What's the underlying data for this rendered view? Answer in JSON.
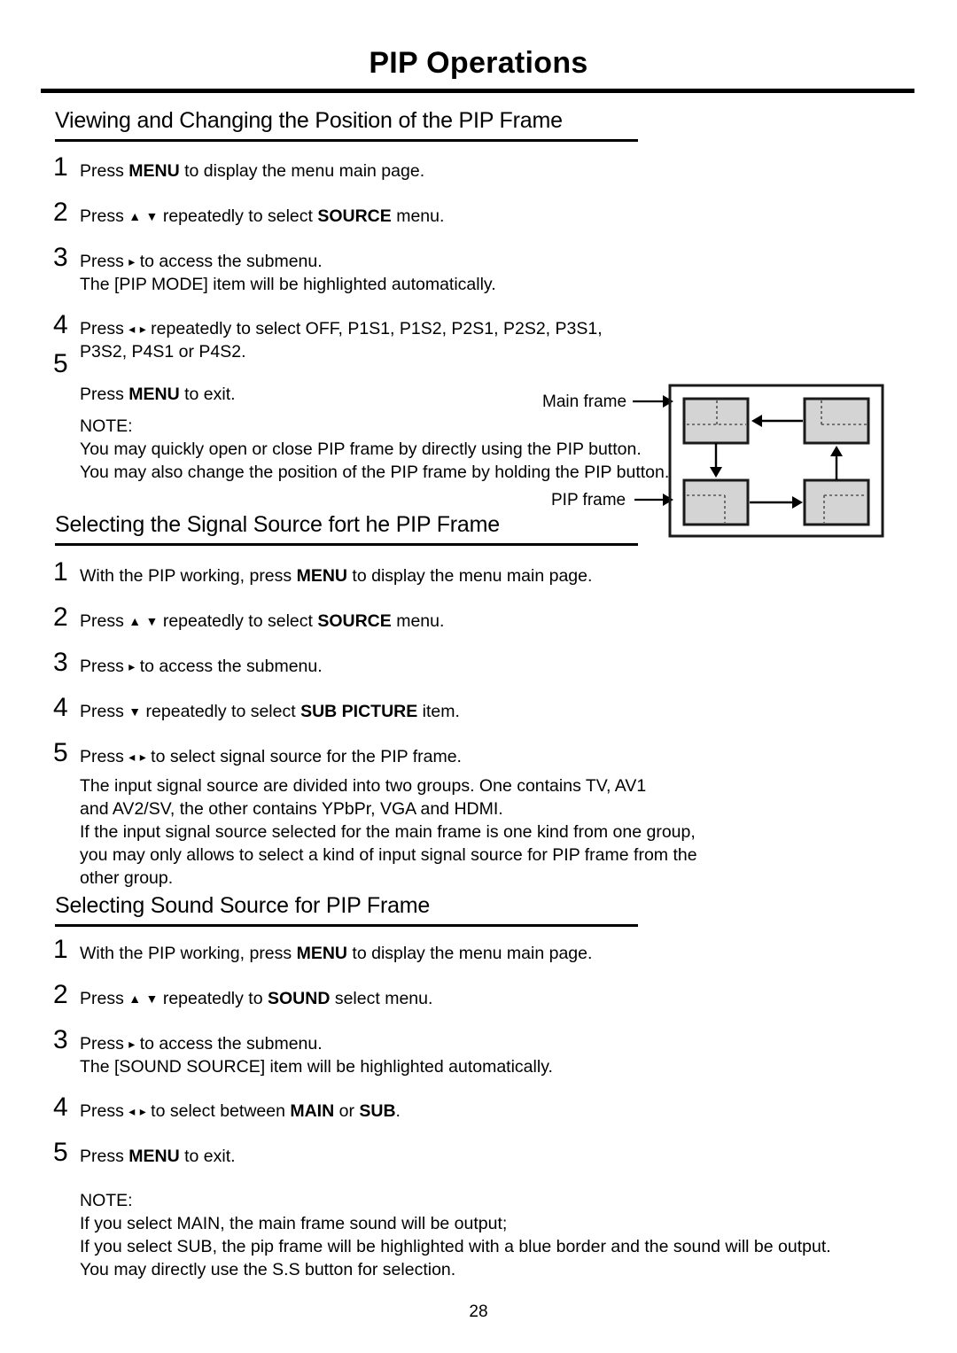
{
  "document": {
    "title": "PIP Operations",
    "page_number": "28"
  },
  "sections": [
    {
      "heading": "Viewing and Changing the Position of the PIP Frame",
      "steps": [
        {
          "num": "1",
          "text_html": "Press <b>MENU</b> to display the menu main page."
        },
        {
          "num": "2",
          "text_html": "Press <span class=\"glyph\">▲</span> <span class=\"glyph\">▼</span> repeatedly to select <b>SOURCE</b> menu."
        },
        {
          "num": "3",
          "text_html": "Press <span class=\"glyph\">▸</span> to access the submenu.<br>The [PIP MODE] item will be highlighted automatically."
        },
        {
          "num": "4",
          "text_html": "Press <span class=\"glyph\">◂</span> <span class=\"glyph\">▸</span> repeatedly to select OFF, P1S1, P1S2, P2S1, P2S2, P3S1,<br>P3S2, P4S1 or P4S2."
        },
        {
          "num": "5",
          "text_html": ""
        }
      ],
      "after_step5_html": "Press <b>MENU</b> to exit.",
      "note_label": "NOTE:",
      "note_lines": [
        "You may quickly open or close PIP frame by directly using the PIP button.",
        "You may also change the position of the PIP frame by holding the PIP button."
      ]
    },
    {
      "heading": "Selecting the Signal Source fort he PIP Frame",
      "steps": [
        {
          "num": "1",
          "text_html": "With the PIP working, press <b>MENU</b> to display the menu main page."
        },
        {
          "num": "2",
          "text_html": "Press <span class=\"glyph\">▲</span> <span class=\"glyph\">▼</span> repeatedly to select <b>SOURCE</b> menu."
        },
        {
          "num": "3",
          "text_html": "Press <span class=\"glyph\">▸</span> to access the submenu."
        },
        {
          "num": "4",
          "text_html": "Press <span class=\"glyph\">▼</span> repeatedly to select <b>SUB PICTURE</b> item."
        },
        {
          "num": "5",
          "text_html": "Press <span class=\"glyph\">◂</span> <span class=\"glyph\">▸</span> to select signal source for the PIP frame."
        }
      ],
      "paragraph_lines": [
        "The input signal source are divided into two groups. One contains TV, AV1",
        "and AV2/SV, the other contains YPbPr, VGA and HDMI.",
        "If the input signal source selected for the main frame is one kind from one group,",
        "you may only allows to select a kind of input signal source for PIP frame from the",
        "other group."
      ]
    },
    {
      "heading": "Selecting Sound Source for PIP Frame",
      "steps": [
        {
          "num": "1",
          "text_html": "With the PIP working, press <b>MENU</b> to display the menu main page."
        },
        {
          "num": "2",
          "text_html": "Press <span class=\"glyph\">▲</span> <span class=\"glyph\">▼</span> repeatedly to <b>SOUND</b> select menu."
        },
        {
          "num": "3",
          "text_html": "Press <span class=\"glyph\">▸</span> to access the submenu.<br>The [SOUND SOURCE] item will be highlighted automatically."
        },
        {
          "num": "4",
          "text_html": "Press <span class=\"glyph\">◂</span> <span class=\"glyph\">▸</span> to select between <b>MAIN</b> or <b>SUB</b>."
        },
        {
          "num": "5",
          "text_html": "Press <b>MENU</b> to exit."
        }
      ],
      "note_label": "NOTE:",
      "note_lines": [
        "If you select MAIN, the main frame sound will be output;",
        "If you select SUB, the pip frame will be highlighted with a blue border and the sound will be output.",
        "You may directly use the S.S button for selection."
      ]
    }
  ],
  "diagram": {
    "main_frame_label": "Main frame",
    "pip_frame_label": "PIP frame",
    "box_fill": "#d4d4d4",
    "box_stroke": "#1a1a1a",
    "boxes": [
      {
        "position": "top-left",
        "pip_quadrant": "bottom-right"
      },
      {
        "position": "top-right",
        "pip_quadrant": "bottom-left"
      },
      {
        "position": "bottom-left",
        "pip_quadrant": "top-right"
      },
      {
        "position": "bottom-right",
        "pip_quadrant": "top-left"
      }
    ],
    "flow": [
      "top-left → bottom-left",
      "bottom-left → bottom-right",
      "bottom-right → top-right",
      "top-right → top-left"
    ]
  }
}
